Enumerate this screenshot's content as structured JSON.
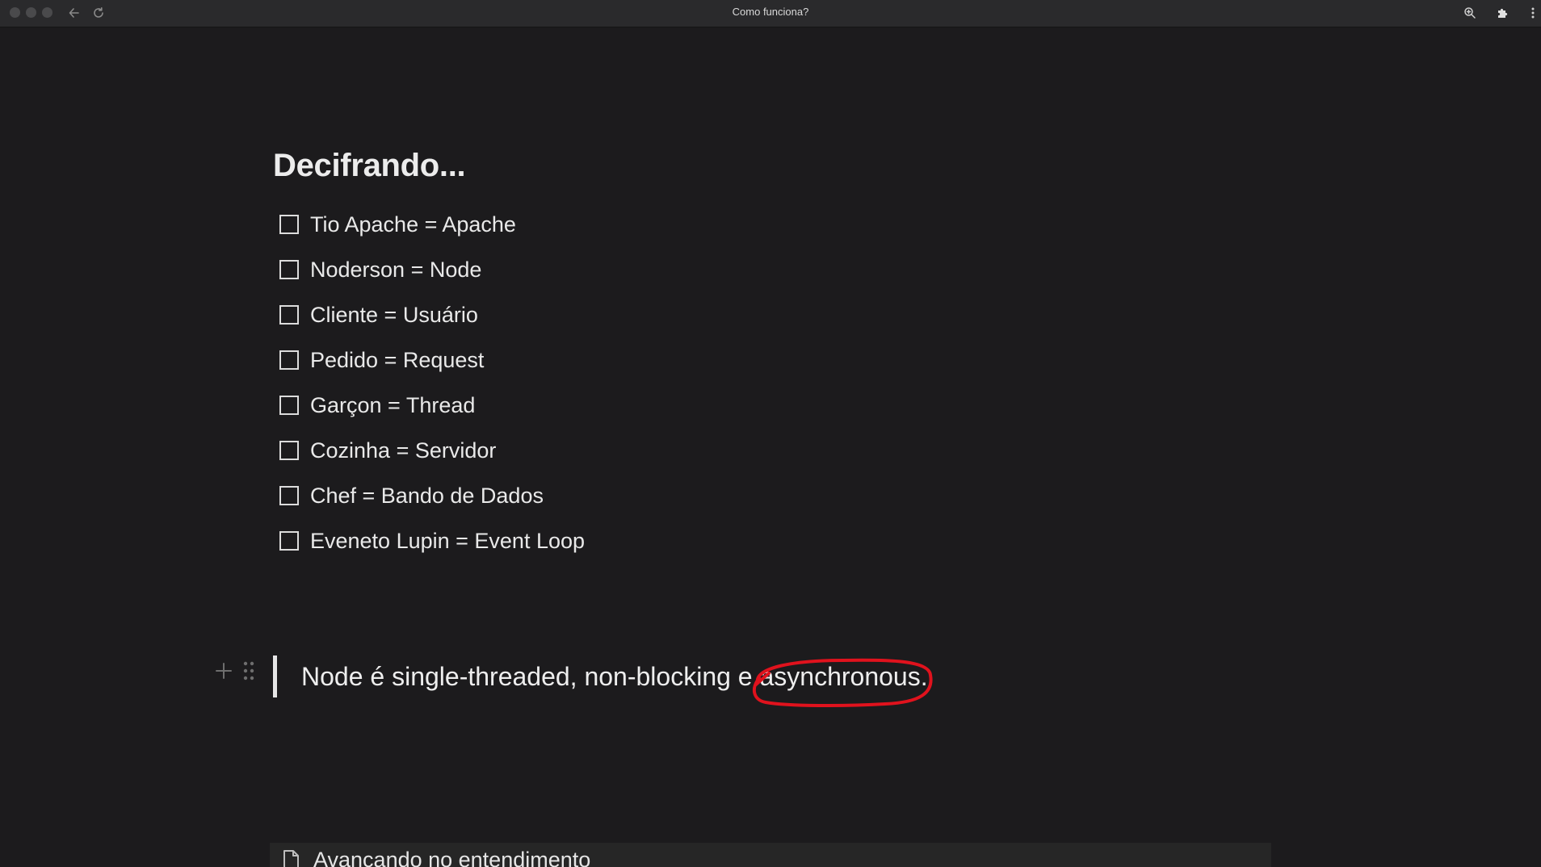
{
  "window": {
    "title": "Como funciona?"
  },
  "toolbar": {
    "back_icon": "arrow-left-icon",
    "reload_icon": "reload-icon",
    "zoom_icon": "zoom-in-icon",
    "extensions_icon": "puzzle-icon",
    "more_icon": "more-vertical-icon"
  },
  "content": {
    "heading": "Decifrando...",
    "todos": [
      {
        "label": "Tio Apache = Apache",
        "checked": false
      },
      {
        "label": "Noderson = Node",
        "checked": false
      },
      {
        "label": "Cliente = Usuário",
        "checked": false
      },
      {
        "label": "Pedido = Request",
        "checked": false
      },
      {
        "label": "Garçon = Thread",
        "checked": false
      },
      {
        "label": "Cozinha = Servidor",
        "checked": false
      },
      {
        "label": "Chef = Bando de Dados",
        "checked": false
      },
      {
        "label": "Eveneto Lupin = Event Loop",
        "checked": false
      }
    ],
    "quote": {
      "text_before": "Node é single-threaded, non-blocking e ",
      "highlighted": "asynchronous.",
      "annotation_color": "#e0121d"
    },
    "page_link": {
      "label": "Avançando no entendimento",
      "icon": "document-icon"
    }
  },
  "colors": {
    "background": "#1c1b1d",
    "titlebar": "#2a2a2c",
    "text": "#e9e9e9"
  }
}
